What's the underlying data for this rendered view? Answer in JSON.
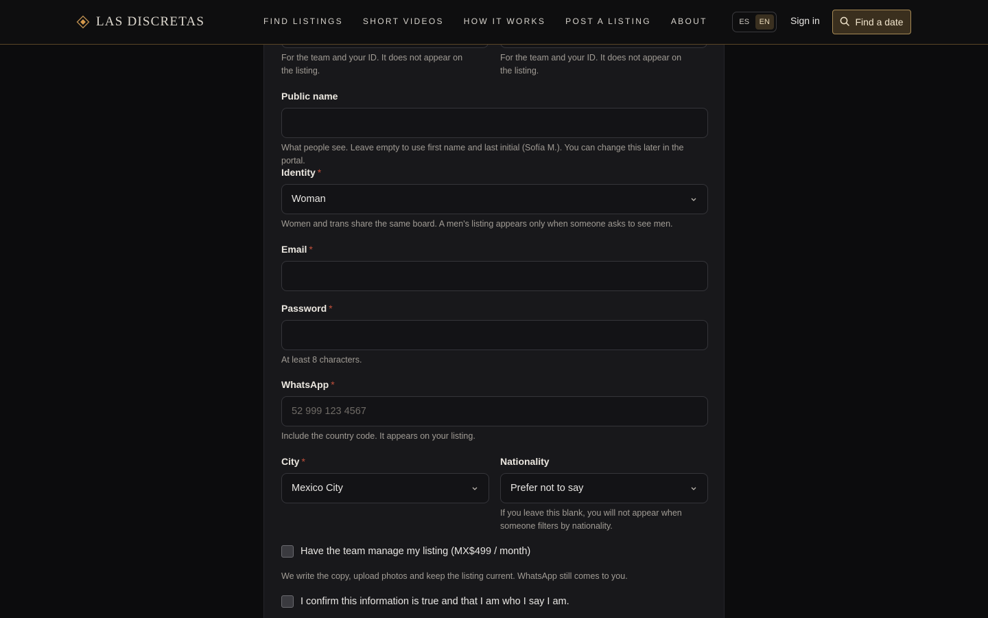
{
  "header": {
    "logo_text": "LAS DISCRETAS",
    "nav": [
      "FIND LISTINGS",
      "SHORT VIDEOS",
      "HOW IT WORKS",
      "POST A LISTING",
      "ABOUT"
    ],
    "lang_es": "ES",
    "lang_en": "EN",
    "signin": "Sign in",
    "find_date": "Find a date"
  },
  "form": {
    "top_help_left": "For the team and your ID. It does not appear on the listing.",
    "top_help_right": "For the team and your ID. It does not appear on the listing.",
    "public_name": {
      "label": "Public name",
      "value": "",
      "help": "What people see. Leave empty to use first name and last initial (Sofía M.). You can change this later in the portal."
    },
    "identity": {
      "label": "Identity",
      "required": "*",
      "value": "Woman",
      "help": "Women and trans share the same board. A men's listing appears only when someone asks to see men."
    },
    "email": {
      "label": "Email",
      "required": "*",
      "value": ""
    },
    "password": {
      "label": "Password",
      "required": "*",
      "value": "",
      "help": "At least 8 characters."
    },
    "whatsapp": {
      "label": "WhatsApp",
      "required": "*",
      "placeholder": "52 999 123 4567",
      "help": "Include the country code. It appears on your listing."
    },
    "city": {
      "label": "City",
      "required": "*",
      "value": "Mexico City"
    },
    "nationality": {
      "label": "Nationality",
      "value": "Prefer not to say",
      "help": "If you leave this blank, you will not appear when someone filters by nationality."
    },
    "managed": {
      "label": "Have the team manage my listing (MX$499 / month)",
      "help": "We write the copy, upload photos and keep the listing current. WhatsApp still comes to you."
    },
    "confirm": {
      "label": "I confirm this information is true and that I am who I say I am."
    }
  },
  "colors": {
    "background": "#0c0c0d",
    "panel": "#18181b",
    "accent_gold": "#a78a55",
    "required_red": "#c2503b"
  },
  "icons": [
    "diamond-logo-icon",
    "search-icon",
    "chevron-down-icon"
  ]
}
